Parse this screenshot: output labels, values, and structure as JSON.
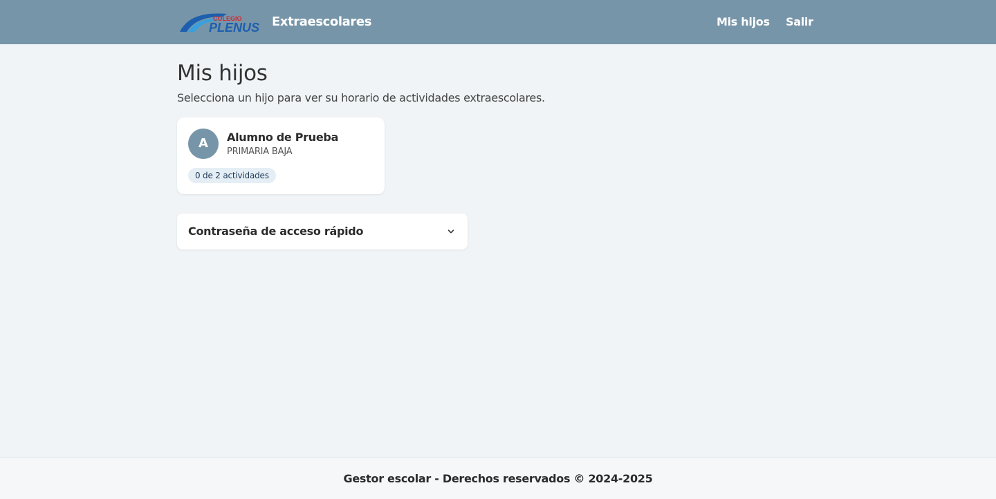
{
  "header": {
    "logo_text_top": "COLEGIO",
    "logo_text_main": "PLENUS",
    "brand": "Extraescolares",
    "nav": [
      {
        "label": "Mis hijos"
      },
      {
        "label": "Salir"
      }
    ]
  },
  "main": {
    "title": "Mis hijos",
    "subtitle": "Selecciona un hijo para ver su horario de actividades extraescolares.",
    "children": [
      {
        "initial": "A",
        "name": "Alumno de Prueba",
        "grade": "PRIMARIA BAJA",
        "activities_badge": "0 de 2 actividades"
      }
    ],
    "accordion": {
      "title": "Contraseña de acceso rápido",
      "icon": "chevron-down-icon"
    }
  },
  "footer": {
    "text": "Gestor escolar - Derechos reservados © 2024-2025"
  },
  "colors": {
    "navbar": "#7795a8",
    "background": "#f0f4f7",
    "avatar": "#7795a8",
    "badge_bg": "#e5eef5",
    "badge_text": "#1f3b57",
    "logo_blue": "#1d5fae",
    "logo_red": "#d7282f"
  }
}
